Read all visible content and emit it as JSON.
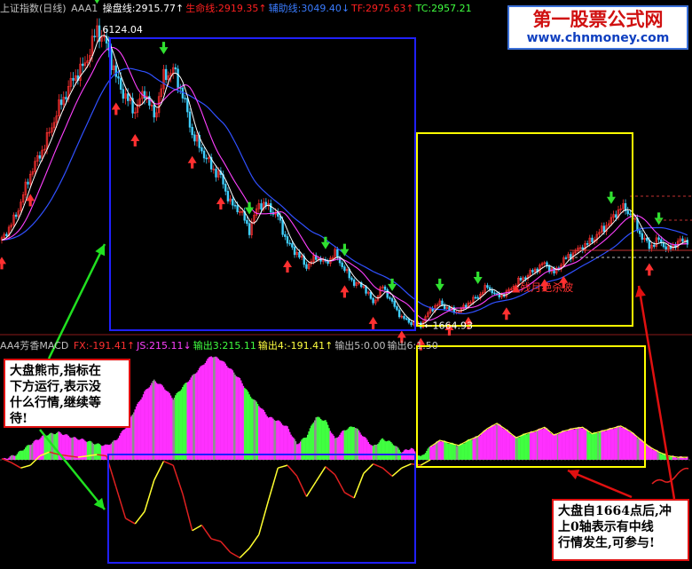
{
  "header_top": {
    "index_name": "上证指数(日线)",
    "formula_name": "AAA1",
    "items": [
      {
        "label": "操盘线:",
        "value": "2915.77",
        "arrow": "↑",
        "color": "#ffffff"
      },
      {
        "label": "生命线:",
        "value": "2919.35",
        "arrow": "↑",
        "color": "#ff2020"
      },
      {
        "label": "辅助线:",
        "value": "3049.40",
        "arrow": "↓",
        "color": "#3a7cff"
      },
      {
        "label": "TF:",
        "value": "2975.63",
        "arrow": "↑",
        "color": "#ff2020"
      },
      {
        "label": "TC:",
        "value": "2957.21",
        "arrow": "",
        "color": "#40ff40"
      }
    ]
  },
  "header_bottom": {
    "formula_name": "AA4芳香MACD",
    "items": [
      {
        "label": "FX:",
        "value": "-191.41",
        "arrow": "↑",
        "color": "#ff3030"
      },
      {
        "label": "JS:",
        "value": "215.11",
        "arrow": "↓",
        "color": "#ff40ff"
      },
      {
        "label": "输出3:",
        "value": "215.11",
        "arrow": "",
        "color": "#40ff40"
      },
      {
        "label": "输出4:",
        "value": "-191.41",
        "arrow": "↑",
        "color": "#ffff40"
      },
      {
        "label": "输出5:",
        "value": "0.00",
        "arrow": "",
        "color": "#c0c0c0"
      },
      {
        "label": "输出6:",
        "value": "1.50",
        "arrow": "",
        "color": "#c0c0c0"
      }
    ]
  },
  "watermark": {
    "line1": "第一股票公式网",
    "line2": "www.chnmoney.com"
  },
  "notes": {
    "left": [
      "大盘熊市,指标在",
      "下方运行,表示没",
      "什么行情,继续等",
      "待!"
    ],
    "right": [
      "大盘自1664点后,冲",
      "上0轴表示有中线",
      "行情发生,可参与!"
    ]
  },
  "colors": {
    "background": "#000000",
    "box_bear": "#2020ff",
    "box_bull": "#ffff00",
    "arrow_annotation": "#20e020",
    "arrow_annotation_red": "#e01010",
    "hist_magenta": "#ff30ff",
    "hist_green": "#40ff40",
    "hist_gray": "#909090",
    "macd_red": "#e02020",
    "macd_yellow": "#ffff30",
    "ma_white": "#ffffff",
    "ma_magenta": "#ff40ff",
    "ma_blue": "#3050ff"
  },
  "chart_data": [
    {
      "type": "candlestick",
      "title": "上证指数(日线)",
      "price_labels": [
        {
          "text": "6124.04",
          "value": 6124.04,
          "kind": "high"
        },
        {
          "text": "1664.93",
          "value": 1664.93,
          "kind": "low"
        },
        {
          "text": "残月绝杀波",
          "kind": "signal",
          "marker": "▲"
        }
      ],
      "close_path": [
        {
          "x": 0,
          "y": 2950
        },
        {
          "x": 6,
          "y": 3320
        },
        {
          "x": 12,
          "y": 3950
        },
        {
          "x": 18,
          "y": 4380
        },
        {
          "x": 24,
          "y": 4950
        },
        {
          "x": 30,
          "y": 5380
        },
        {
          "x": 35,
          "y": 5600
        },
        {
          "x": 40,
          "y": 6124
        },
        {
          "x": 44,
          "y": 5900
        },
        {
          "x": 48,
          "y": 5400
        },
        {
          "x": 52,
          "y": 5100
        },
        {
          "x": 56,
          "y": 4900
        },
        {
          "x": 60,
          "y": 5200
        },
        {
          "x": 64,
          "y": 4800
        },
        {
          "x": 68,
          "y": 5400
        },
        {
          "x": 72,
          "y": 5520
        },
        {
          "x": 76,
          "y": 5150
        },
        {
          "x": 80,
          "y": 4550
        },
        {
          "x": 84,
          "y": 4300
        },
        {
          "x": 88,
          "y": 4050
        },
        {
          "x": 92,
          "y": 3900
        },
        {
          "x": 96,
          "y": 3500
        },
        {
          "x": 100,
          "y": 3400
        },
        {
          "x": 104,
          "y": 3100
        },
        {
          "x": 108,
          "y": 3500
        },
        {
          "x": 112,
          "y": 3450
        },
        {
          "x": 116,
          "y": 3300
        },
        {
          "x": 120,
          "y": 2900
        },
        {
          "x": 124,
          "y": 2750
        },
        {
          "x": 128,
          "y": 2550
        },
        {
          "x": 132,
          "y": 2700
        },
        {
          "x": 136,
          "y": 2600
        },
        {
          "x": 140,
          "y": 2750
        },
        {
          "x": 144,
          "y": 2500
        },
        {
          "x": 148,
          "y": 2300
        },
        {
          "x": 152,
          "y": 2250
        },
        {
          "x": 156,
          "y": 2000
        },
        {
          "x": 160,
          "y": 2250
        },
        {
          "x": 164,
          "y": 2000
        },
        {
          "x": 168,
          "y": 1780
        },
        {
          "x": 172,
          "y": 1700
        },
        {
          "x": 176,
          "y": 1664.93
        },
        {
          "x": 180,
          "y": 1900
        },
        {
          "x": 184,
          "y": 2000
        },
        {
          "x": 188,
          "y": 1900
        },
        {
          "x": 192,
          "y": 1870
        },
        {
          "x": 196,
          "y": 2000
        },
        {
          "x": 200,
          "y": 2100
        },
        {
          "x": 204,
          "y": 2250
        },
        {
          "x": 208,
          "y": 2100
        },
        {
          "x": 212,
          "y": 2150
        },
        {
          "x": 216,
          "y": 2300
        },
        {
          "x": 220,
          "y": 2400
        },
        {
          "x": 224,
          "y": 2500
        },
        {
          "x": 228,
          "y": 2600
        },
        {
          "x": 232,
          "y": 2450
        },
        {
          "x": 236,
          "y": 2650
        },
        {
          "x": 240,
          "y": 2750
        },
        {
          "x": 244,
          "y": 2850
        },
        {
          "x": 248,
          "y": 2950
        },
        {
          "x": 252,
          "y": 3100
        },
        {
          "x": 256,
          "y": 3250
        },
        {
          "x": 260,
          "y": 3450
        },
        {
          "x": 264,
          "y": 3350
        },
        {
          "x": 268,
          "y": 3050
        },
        {
          "x": 272,
          "y": 2850
        },
        {
          "x": 276,
          "y": 2950
        },
        {
          "x": 280,
          "y": 2800
        },
        {
          "x": 284,
          "y": 2920
        },
        {
          "x": 288,
          "y": 2950
        }
      ],
      "ylim": [
        1550,
        6300
      ],
      "xlim": [
        0,
        300
      ]
    },
    {
      "type": "histogram",
      "title": "AA4芳香MACD",
      "histogram": [
        {
          "x": 0,
          "v": 0
        },
        {
          "x": 6,
          "v": 40
        },
        {
          "x": 12,
          "v": 120
        },
        {
          "x": 18,
          "v": 190
        },
        {
          "x": 24,
          "v": 210
        },
        {
          "x": 30,
          "v": 170
        },
        {
          "x": 35,
          "v": 150
        },
        {
          "x": 40,
          "v": 120
        },
        {
          "x": 44,
          "v": 110
        },
        {
          "x": 48,
          "v": 150
        },
        {
          "x": 52,
          "v": 250
        },
        {
          "x": 56,
          "v": 390
        },
        {
          "x": 60,
          "v": 520
        },
        {
          "x": 64,
          "v": 610
        },
        {
          "x": 68,
          "v": 560
        },
        {
          "x": 72,
          "v": 470
        },
        {
          "x": 76,
          "v": 560
        },
        {
          "x": 80,
          "v": 640
        },
        {
          "x": 84,
          "v": 720
        },
        {
          "x": 88,
          "v": 800
        },
        {
          "x": 92,
          "v": 770
        },
        {
          "x": 96,
          "v": 700
        },
        {
          "x": 100,
          "v": 620
        },
        {
          "x": 104,
          "v": 500
        },
        {
          "x": 108,
          "v": 420
        },
        {
          "x": 112,
          "v": 330
        },
        {
          "x": 116,
          "v": 300
        },
        {
          "x": 120,
          "v": 250
        },
        {
          "x": 124,
          "v": 120
        },
        {
          "x": 128,
          "v": 180
        },
        {
          "x": 132,
          "v": 330
        },
        {
          "x": 136,
          "v": 300
        },
        {
          "x": 140,
          "v": 160
        },
        {
          "x": 144,
          "v": 230
        },
        {
          "x": 148,
          "v": 260
        },
        {
          "x": 152,
          "v": 180
        },
        {
          "x": 156,
          "v": 100
        },
        {
          "x": 160,
          "v": 160
        },
        {
          "x": 164,
          "v": 130
        },
        {
          "x": 168,
          "v": 60
        },
        {
          "x": 172,
          "v": 90
        },
        {
          "x": 176,
          "v": 20
        },
        {
          "x": 180,
          "v": 100
        },
        {
          "x": 184,
          "v": 150
        },
        {
          "x": 188,
          "v": 130
        },
        {
          "x": 192,
          "v": 110
        },
        {
          "x": 196,
          "v": 150
        },
        {
          "x": 200,
          "v": 180
        },
        {
          "x": 204,
          "v": 240
        },
        {
          "x": 208,
          "v": 280
        },
        {
          "x": 212,
          "v": 230
        },
        {
          "x": 216,
          "v": 170
        },
        {
          "x": 220,
          "v": 200
        },
        {
          "x": 224,
          "v": 220
        },
        {
          "x": 228,
          "v": 250
        },
        {
          "x": 232,
          "v": 190
        },
        {
          "x": 236,
          "v": 220
        },
        {
          "x": 240,
          "v": 240
        },
        {
          "x": 244,
          "v": 250
        },
        {
          "x": 248,
          "v": 200
        },
        {
          "x": 252,
          "v": 220
        },
        {
          "x": 256,
          "v": 240
        },
        {
          "x": 260,
          "v": 260
        },
        {
          "x": 264,
          "v": 220
        },
        {
          "x": 268,
          "v": 160
        },
        {
          "x": 272,
          "v": 100
        },
        {
          "x": 276,
          "v": 60
        },
        {
          "x": 280,
          "v": 30
        },
        {
          "x": 284,
          "v": 20
        },
        {
          "x": 288,
          "v": 20
        }
      ],
      "macd_line": [
        {
          "x": 0,
          "v": 10
        },
        {
          "x": 4,
          "v": -20
        },
        {
          "x": 8,
          "v": -60
        },
        {
          "x": 12,
          "v": -40
        },
        {
          "x": 16,
          "v": 30
        },
        {
          "x": 20,
          "v": 60
        },
        {
          "x": 24,
          "v": 40
        },
        {
          "x": 28,
          "v": 30
        },
        {
          "x": 32,
          "v": 20
        },
        {
          "x": 36,
          "v": 30
        },
        {
          "x": 40,
          "v": 40
        },
        {
          "x": 44,
          "v": 30
        },
        {
          "x": 48,
          "v": -200
        },
        {
          "x": 52,
          "v": -430
        },
        {
          "x": 56,
          "v": -470
        },
        {
          "x": 60,
          "v": -380
        },
        {
          "x": 64,
          "v": -150
        },
        {
          "x": 68,
          "v": -10
        },
        {
          "x": 72,
          "v": -40
        },
        {
          "x": 76,
          "v": -250
        },
        {
          "x": 80,
          "v": -520
        },
        {
          "x": 84,
          "v": -480
        },
        {
          "x": 88,
          "v": -580
        },
        {
          "x": 92,
          "v": -600
        },
        {
          "x": 96,
          "v": -680
        },
        {
          "x": 100,
          "v": -720
        },
        {
          "x": 104,
          "v": -650
        },
        {
          "x": 108,
          "v": -550
        },
        {
          "x": 112,
          "v": -300
        },
        {
          "x": 116,
          "v": -60
        },
        {
          "x": 120,
          "v": -40
        },
        {
          "x": 124,
          "v": -120
        },
        {
          "x": 128,
          "v": -270
        },
        {
          "x": 132,
          "v": -160
        },
        {
          "x": 136,
          "v": -50
        },
        {
          "x": 140,
          "v": -110
        },
        {
          "x": 144,
          "v": -240
        },
        {
          "x": 148,
          "v": -280
        },
        {
          "x": 152,
          "v": -100
        },
        {
          "x": 156,
          "v": -30
        },
        {
          "x": 160,
          "v": -60
        },
        {
          "x": 164,
          "v": -120
        },
        {
          "x": 168,
          "v": -60
        },
        {
          "x": 172,
          "v": -30
        },
        {
          "x": 176,
          "v": -40
        },
        {
          "x": 180,
          "v": 0
        }
      ],
      "ylim": [
        -750,
        900
      ],
      "xlim": [
        0,
        300
      ]
    }
  ]
}
